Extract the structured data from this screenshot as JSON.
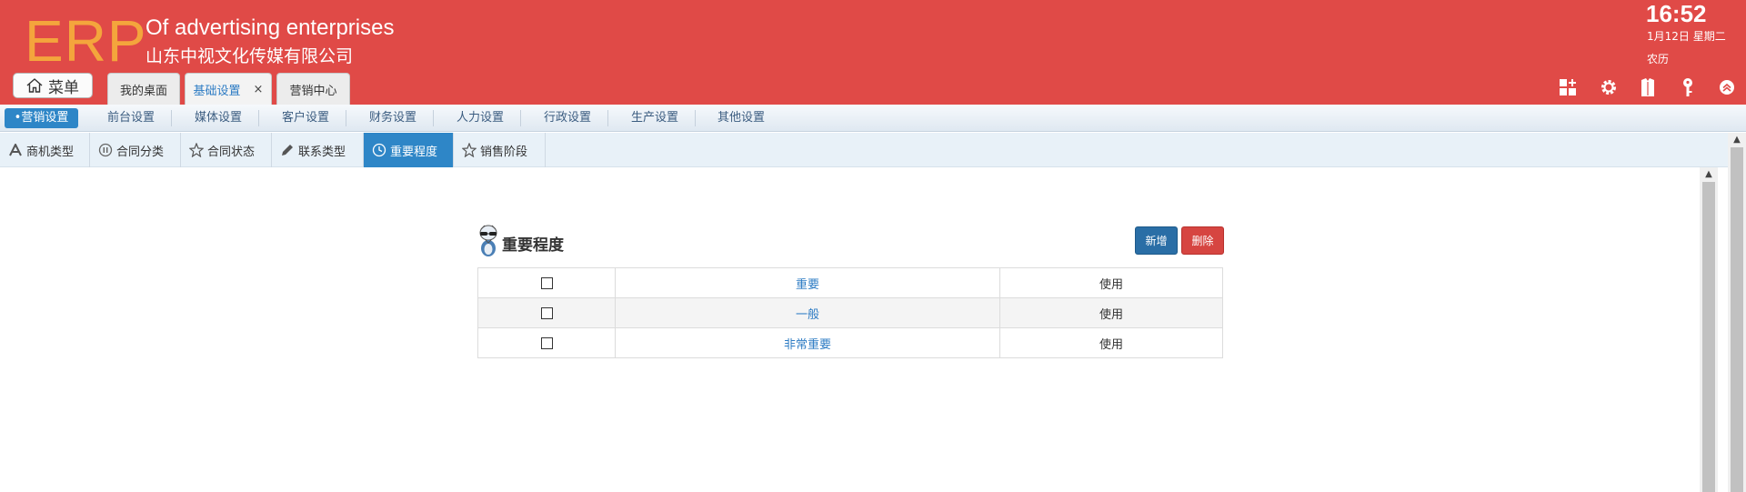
{
  "header": {
    "logo": "ERP",
    "tagline": "Of advertising enterprises",
    "company": "山东中视文化传媒有限公司",
    "time": "16:52",
    "date": "1月12日 星期二",
    "lunar": "农历",
    "menu_label": "菜单",
    "tabs": [
      {
        "label": "我的桌面"
      },
      {
        "label": "基础设置",
        "close": "×"
      },
      {
        "label": "营销中心"
      }
    ],
    "icons": [
      "grid-add-icon",
      "gear-icon",
      "shirt-icon",
      "key-icon",
      "chevron-up-circle-icon"
    ]
  },
  "subnav": {
    "items": [
      {
        "label": "•营销设置",
        "active": true
      },
      {
        "label": "前台设置"
      },
      {
        "label": "媒体设置"
      },
      {
        "label": "客户设置"
      },
      {
        "label": "财务设置"
      },
      {
        "label": "人力设置"
      },
      {
        "label": "行政设置"
      },
      {
        "label": "生产设置"
      },
      {
        "label": "其他设置"
      }
    ]
  },
  "tooltabs": {
    "items": [
      {
        "label": "商机类型",
        "icon": "font-a-icon"
      },
      {
        "label": "合同分类",
        "icon": "pause-circle-icon"
      },
      {
        "label": "合同状态",
        "icon": "star-icon"
      },
      {
        "label": "联系类型",
        "icon": "pencil-icon"
      },
      {
        "label": "重要程度",
        "icon": "clock-icon",
        "active": true
      },
      {
        "label": "销售阶段",
        "icon": "star-icon"
      }
    ]
  },
  "panel": {
    "title": "重要程度",
    "add_label": "新增",
    "delete_label": "删除",
    "rows": [
      {
        "name": "重要",
        "status": "使用"
      },
      {
        "name": "一般",
        "status": "使用"
      },
      {
        "name": "非常重要",
        "status": "使用"
      }
    ]
  },
  "colors": {
    "header_bg": "#e04a47",
    "logo": "#f4a53c",
    "accent_blue": "#2e86c7",
    "link_blue": "#2e7cc4",
    "delete_red": "#d64541"
  }
}
